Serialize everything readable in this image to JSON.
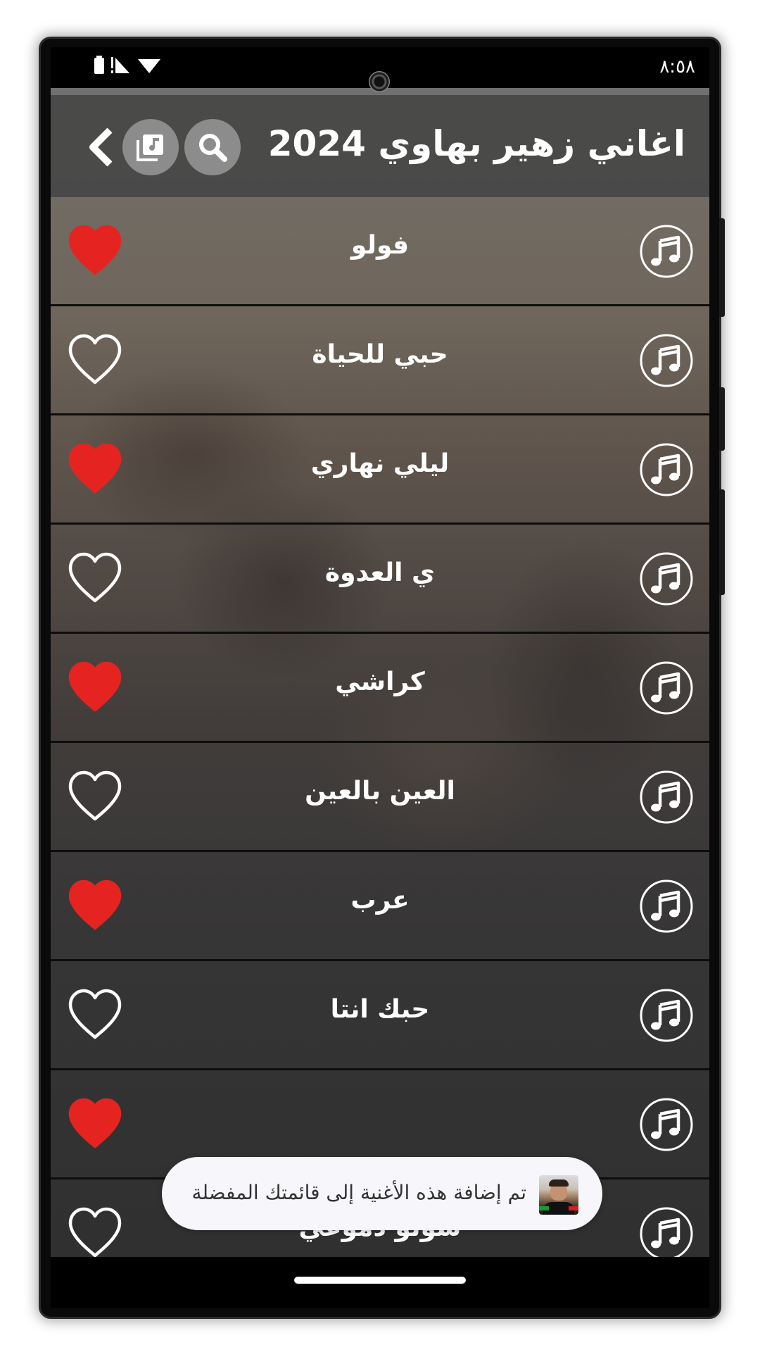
{
  "status_bar": {
    "time": "٨:٥٨"
  },
  "header": {
    "title": "اغاني زهير بهاوي 2024",
    "search_icon": "search-icon",
    "library_icon": "music-library-icon",
    "back_icon": "chevron-left-icon"
  },
  "songs": [
    {
      "title": "فولو",
      "favorite": true
    },
    {
      "title": "حبي للحياة",
      "favorite": false
    },
    {
      "title": "ليلي نهاري",
      "favorite": true
    },
    {
      "title": "ي العدوة",
      "favorite": false
    },
    {
      "title": "كراشي",
      "favorite": true
    },
    {
      "title": "العين بالعين",
      "favorite": false
    },
    {
      "title": "عرب",
      "favorite": true
    },
    {
      "title": "حبك انتا",
      "favorite": false
    },
    {
      "title": "",
      "favorite": true
    },
    {
      "title": "سولو دموعي",
      "favorite": false
    }
  ],
  "toast": {
    "message": "تم إضافة هذه الأغنية إلى قائمتك المفضلة"
  },
  "colors": {
    "heart_active": "#e52421",
    "heart_inactive": "#ffffff",
    "header_bg": "#464646",
    "header_button_bg": "#8c8c8c"
  }
}
